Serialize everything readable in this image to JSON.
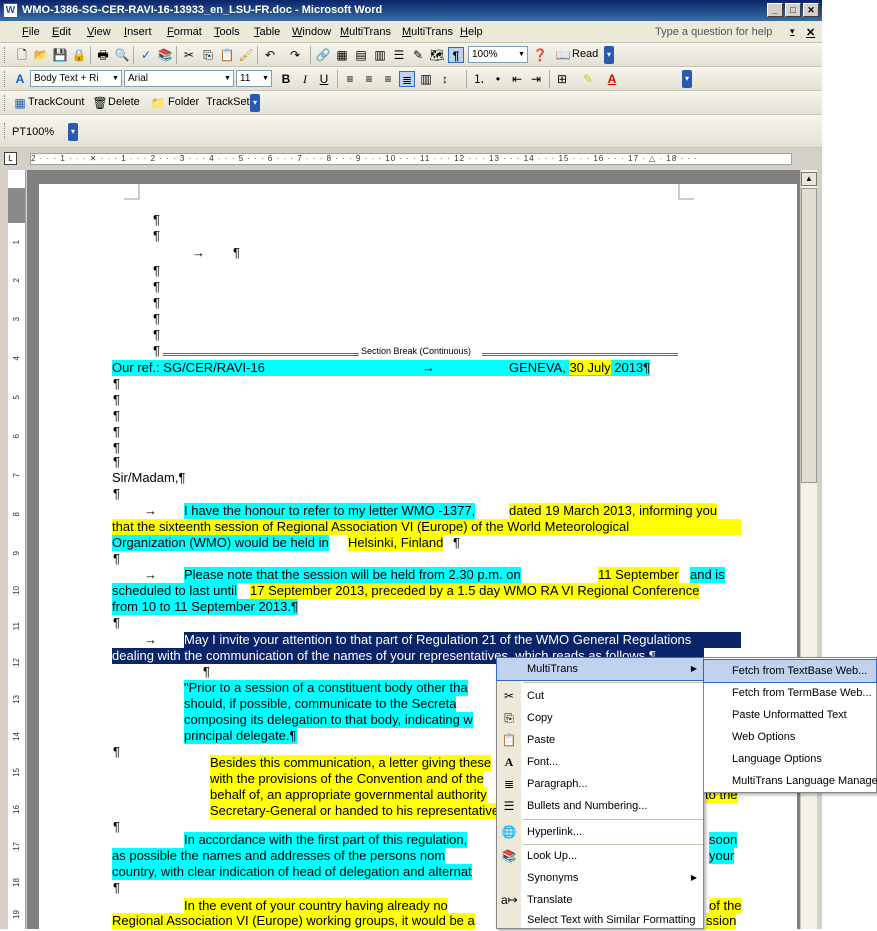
{
  "window": {
    "title": "WMO-1386-SG-CER-RAVI-16-13933_en_LSU-FR.doc - Microsoft Word"
  },
  "menubar": {
    "items": [
      "File",
      "Edit",
      "View",
      "Insert",
      "Format",
      "Tools",
      "Table",
      "Window",
      "MultiTrans",
      "MultiTrans",
      "Help"
    ],
    "help_placeholder": "Type a question for help"
  },
  "toolbar_standard": {
    "zoom": "100%",
    "read_label": "Read"
  },
  "toolbar_format": {
    "style": "Body Text + Ri",
    "font": "Arial",
    "size": "11",
    "bold": "B",
    "italic": "I",
    "underline": "U"
  },
  "toolbar_track": {
    "items": [
      "TrackCount",
      "Delete",
      "Folder",
      "TrackSet"
    ]
  },
  "toolbar_pt": {
    "label": "PT100%"
  },
  "ruler": {
    "text": "2 · · · 1 · · · ✕ · · · 1 · · · 2 · · · 3 · · · 4 · · · 5 · · · 6 · · · 7 · · · 8 · · · 9 · · · 10 · · · 11 · · · 12 · · · 13 · · · 14 · · · 15 · · · 16 · · · 17 · △ · 18 · · ·"
  },
  "vruler": {
    "marks": [
      "1",
      "2",
      "3",
      "4",
      "5",
      "6",
      "7",
      "8",
      "9",
      "10",
      "11",
      "12",
      "13",
      "14",
      "15",
      "16",
      "17",
      "18",
      "19"
    ]
  },
  "doc": {
    "pilcrow": "¶",
    "arrow": "→",
    "section_break": "Section Break (Continuous)",
    "ref_label": "Our ref.: SG/CER/RAVI-16",
    "geneva": "GENEVA, ",
    "date": "30 July",
    "year": " 2013¶",
    "salutation": "Sir/Madam,¶",
    "p1": [
      {
        "t": "I have the honour to refer to my letter WMO -1377, ",
        "h": "c"
      },
      {
        "t": "dated 19 March 2013, informing you",
        "h": "y"
      },
      {
        "t": "that the sixteenth session of Regional Association VI (Europe) of the World Meteorological",
        "h": "y"
      },
      {
        "t": "Organization (WMO) would be held in ",
        "h": "c"
      },
      {
        "t": "Helsinki, Finland",
        "h": "y"
      },
      {
        "t": "¶",
        "h": ""
      }
    ],
    "p2": [
      {
        "t": "Please note that the session will be held from 2.30 p.m. on ",
        "h": "c"
      },
      {
        "t": "11 September",
        "h": "y"
      },
      {
        "t": " and is",
        "h": "c"
      },
      {
        "t": "scheduled to last until ",
        "h": "c"
      },
      {
        "t": "17 September 2013, preceded by a 1.5 day WMO RA VI Regional Conference",
        "h": "y"
      },
      {
        "t": "from 10 to 11 September 2013.¶",
        "h": "c"
      }
    ],
    "p3": [
      "May I invite your attention to that part of Regulation 21 of the WMO General Regulations",
      "dealing with the communication of the names of your representatives, which reads as follows ¶"
    ],
    "quote": [
      "\"Prior to a session of a constituent body other tha",
      "should, if possible, communicate to the Secreta",
      "composing its delegation to that body, indicating w",
      "principal delegate.¶"
    ],
    "p4": [
      "Besides this communication, a letter giving these",
      "with the provisions of the Convention and of the",
      "behalf of, an appropriate governmental authority",
      "Secretary-General or handed to his representative"
    ],
    "p4_tail": "to the",
    "p5": [
      "In accordance with the first part of this regulation,",
      "as possible the names and addresses of the persons nom",
      "country, with clear indication of head of delegation and alternat"
    ],
    "p5_tail1": "soon",
    "p5_tail2": "your",
    "p6": [
      "In the event of your country having already no",
      "Regional Association VI (Europe) working groups, it would be a"
    ],
    "p6_tail1": "of the",
    "p6_tail2": "ssion"
  },
  "context_menu": {
    "items": [
      "MultiTrans",
      "Cut",
      "Copy",
      "Paste",
      "Font...",
      "Paragraph...",
      "Bullets and Numbering...",
      "Hyperlink...",
      "Look Up...",
      "Synonyms",
      "Translate",
      "Select Text with Similar Formatting"
    ]
  },
  "submenu": {
    "items": [
      "Fetch from TextBase Web...",
      "Fetch from TermBase Web...",
      "Paste Unformatted Text",
      "Web Options",
      "Language Options",
      "MultiTrans Language Manager"
    ]
  }
}
